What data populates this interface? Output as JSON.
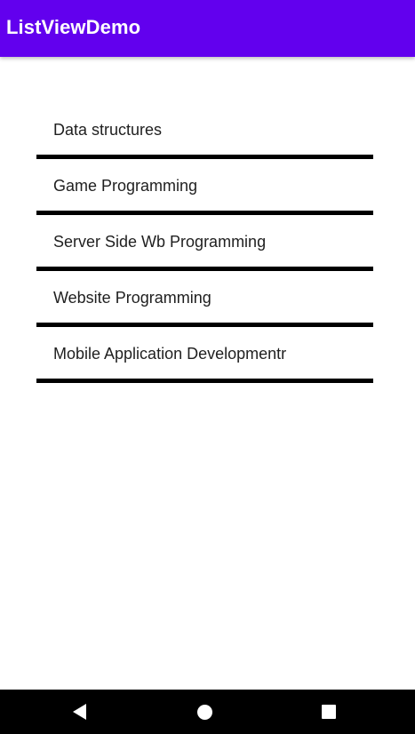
{
  "app_bar": {
    "title": "ListViewDemo",
    "color": "#6200ee"
  },
  "list": {
    "items": [
      {
        "label": "Data structures"
      },
      {
        "label": "Game Programming"
      },
      {
        "label": "Server Side Wb Programming"
      },
      {
        "label": "Website Programming"
      },
      {
        "label": "Mobile Application Developmentr"
      }
    ],
    "divider_color": "#000000"
  },
  "nav_bar": {
    "back_icon": "back-triangle-icon",
    "home_icon": "home-circle-icon",
    "recents_icon": "recents-square-icon"
  }
}
